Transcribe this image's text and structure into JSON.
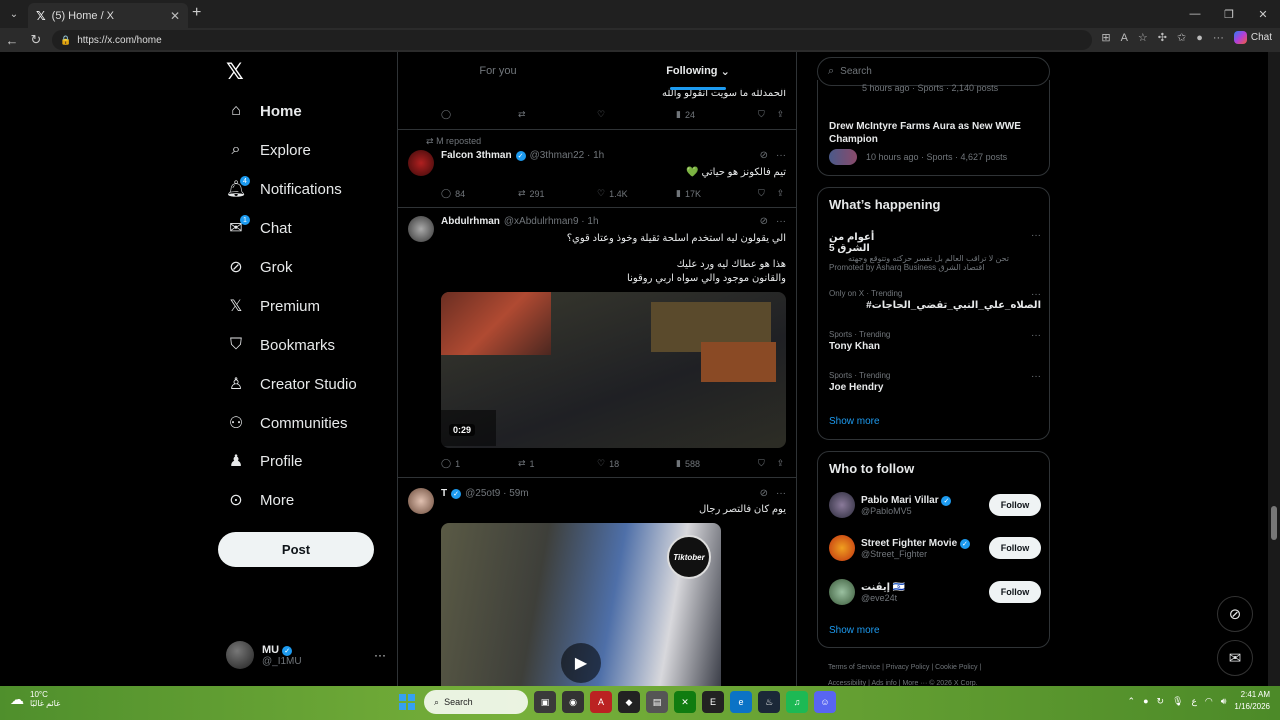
{
  "browser": {
    "tab_title": "(5) Home / X",
    "url": "https://x.com/home",
    "chat_label": "Chat"
  },
  "nav": {
    "items": [
      {
        "label": "Home",
        "icon": "home-icon",
        "active": true
      },
      {
        "label": "Explore",
        "icon": "search-icon"
      },
      {
        "label": "Notifications",
        "icon": "bell-icon",
        "badge": "4"
      },
      {
        "label": "Chat",
        "icon": "mail-icon",
        "badge": "1"
      },
      {
        "label": "Grok",
        "icon": "grok-icon"
      },
      {
        "label": "Premium",
        "icon": "x-icon"
      },
      {
        "label": "Bookmarks",
        "icon": "bookmark-icon"
      },
      {
        "label": "Creator Studio",
        "icon": "creator-icon"
      },
      {
        "label": "Communities",
        "icon": "communities-icon"
      },
      {
        "label": "Profile",
        "icon": "person-icon"
      },
      {
        "label": "More",
        "icon": "more-circle-icon"
      }
    ],
    "post_label": "Post",
    "account": {
      "name": "MU",
      "handle": "@_I1MU"
    }
  },
  "timeline": {
    "tabs": [
      "For you",
      "Following"
    ],
    "tweet0": {
      "text": "الحمدلله ما سويت انقولو والله",
      "views": "24"
    },
    "tweet1": {
      "repost_by": "M reposted",
      "name": "Falcon 3thman",
      "handle": "@3thman22",
      "time": "1h",
      "text": "تيم فالكونز هو حياتي 💚",
      "replies": "84",
      "reposts": "291",
      "likes": "1.4K",
      "views": "17K"
    },
    "tweet2": {
      "name": "Abdulrhman",
      "handle": "@xAbdulrhman9",
      "time": "1h",
      "line1": "الي يقولون ليه استخدم اسلحة ثقيلة وخوذ وعتاد قوي؟",
      "line2": "هذا هو عطاك ليه ورد عليك",
      "line3": "والقانون موجود والي سواه اربي روقونا",
      "duration": "0:29",
      "replies": "1",
      "reposts": "1",
      "likes": "18",
      "views": "588"
    },
    "tweet3": {
      "name": "T",
      "handle": "@25ot9",
      "time": "59m",
      "text": "يوم كان فالتصر رجال",
      "logo_text": "Tiktober"
    }
  },
  "right": {
    "search_placeholder": "Search",
    "trend_top_meta": "5 hours ago · Sports · 2,140 posts",
    "trend_top2_title": "Drew McIntyre Farms Aura as New WWE Champion",
    "trend_top2_meta": "10 hours ago · Sports · 4,627 posts",
    "whats_happening": "What’s happening",
    "trends": [
      {
        "name": "أعوام من الشرق 5",
        "ctx": "تحن لا تراقب العالم بل تفسر حركته وتتوقع وجهته",
        "ctx2": "Promoted by Asharq Business اقتصاد الشرق"
      },
      {
        "ctx": "Only on X · Trending",
        "name": "#الصلاه_علي_النبي_تقضي_الحاجات"
      },
      {
        "ctx": "Sports · Trending",
        "name": "Tony Khan"
      },
      {
        "ctx": "Sports · Trending",
        "name": "Joe Hendry"
      }
    ],
    "show_more": "Show more",
    "who_to_follow": "Who to follow",
    "follow_label": "Follow",
    "suggestions": [
      {
        "name": "Pablo Mari Villar",
        "handle": "@PabloMV5",
        "verified": true
      },
      {
        "name": "Street Fighter Movie",
        "handle": "@Street_Fighter",
        "verified": true
      },
      {
        "name": "إيڤنت 🇮🇱",
        "handle": "@eve24t",
        "verified": false
      }
    ],
    "footer_line1": "Terms of Service  |  Privacy Policy  |  Cookie Policy  |",
    "footer_line2": "Accessibility  |  Ads info  |  More ···  © 2026 X Corp."
  },
  "taskbar": {
    "temp": "10°C",
    "weather_text": "غائم غالبًا",
    "search_label": "Search",
    "time": "2:41 AM",
    "date": "1/16/2026",
    "lang": "ع"
  },
  "colors": {
    "accent": "#1d9bf0",
    "bg": "#000000",
    "border": "#2f3336"
  }
}
